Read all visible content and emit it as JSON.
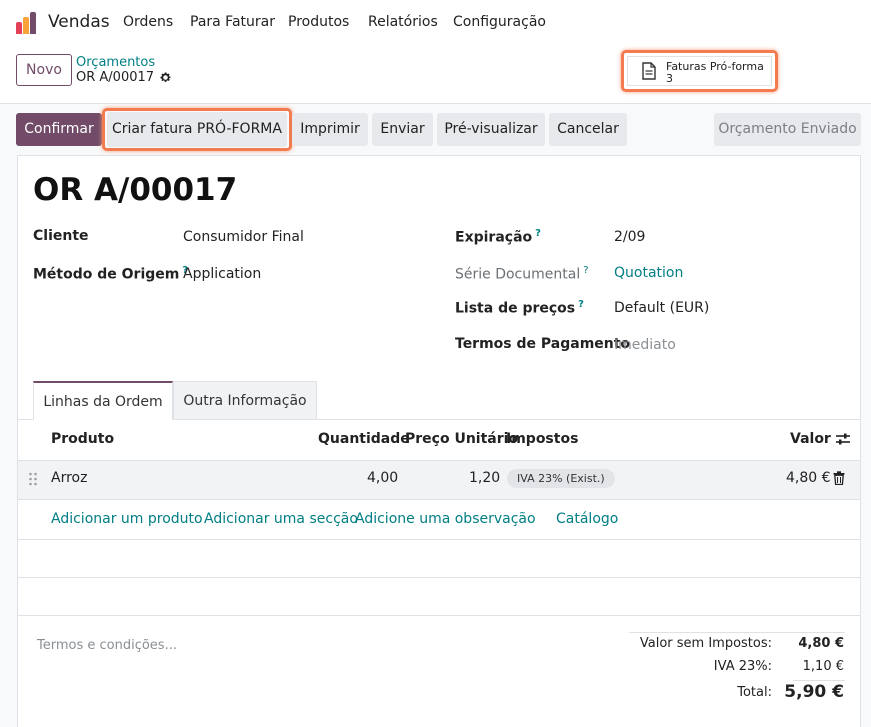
{
  "nav": {
    "app_name": "Vendas",
    "menu": [
      "Ordens",
      "Para Faturar",
      "Produtos",
      "Relatórios",
      "Configuração"
    ]
  },
  "control": {
    "new_label": "Novo",
    "breadcrumb_parent": "Orçamentos",
    "breadcrumb_current": "OR A/00017",
    "smart_button": {
      "label": "Faturas Pró-forma",
      "count": "3"
    }
  },
  "actions": {
    "confirm": "Confirmar",
    "proforma": "Criar fatura PRÓ-FORMA",
    "print": "Imprimir",
    "send": "Enviar",
    "preview": "Pré-visualizar",
    "cancel": "Cancelar",
    "status": "Orçamento Enviado"
  },
  "record": {
    "title": "OR A/00017",
    "fields_left": [
      {
        "label": "Cliente",
        "help": "",
        "value": "Consumidor Final"
      },
      {
        "label": "Método de Origem",
        "help": "?",
        "value": "Application"
      }
    ],
    "fields_right": [
      {
        "label": "Expiração",
        "help": "?",
        "value": "2/09"
      },
      {
        "label": "Série Documental",
        "help": "?",
        "value": "Quotation"
      },
      {
        "label": "Lista de preços",
        "help": "?",
        "value": "Default (EUR)"
      },
      {
        "label": "Termos de Pagamento",
        "help": "",
        "value": "Imediato"
      }
    ]
  },
  "tabs": [
    "Linhas da Ordem",
    "Outra Informação"
  ],
  "table": {
    "headers": [
      "Produto",
      "Quantidade",
      "Preço Unitário",
      "Impostos",
      "Valor"
    ],
    "rows": [
      {
        "product": "Arroz",
        "qty": "4,00",
        "price": "1,20",
        "tax": "IVA 23% (Exist.)",
        "amount": "4,80 €"
      }
    ],
    "add_links": [
      "Adicionar um produto",
      "Adicionar uma secção",
      "Adicione uma observação",
      "Catálogo"
    ]
  },
  "footer": {
    "terms_placeholder": "Termos e condições...",
    "untaxed_label": "Valor sem Impostos:",
    "untaxed_value": "4,80 €",
    "tax_label": "IVA 23%:",
    "tax_value": "1,10 €",
    "total_label": "Total:",
    "total_value": "5,90 €"
  },
  "colors": {
    "brand": "#714b67",
    "link": "#017e84",
    "highlight": "#f27b50"
  }
}
